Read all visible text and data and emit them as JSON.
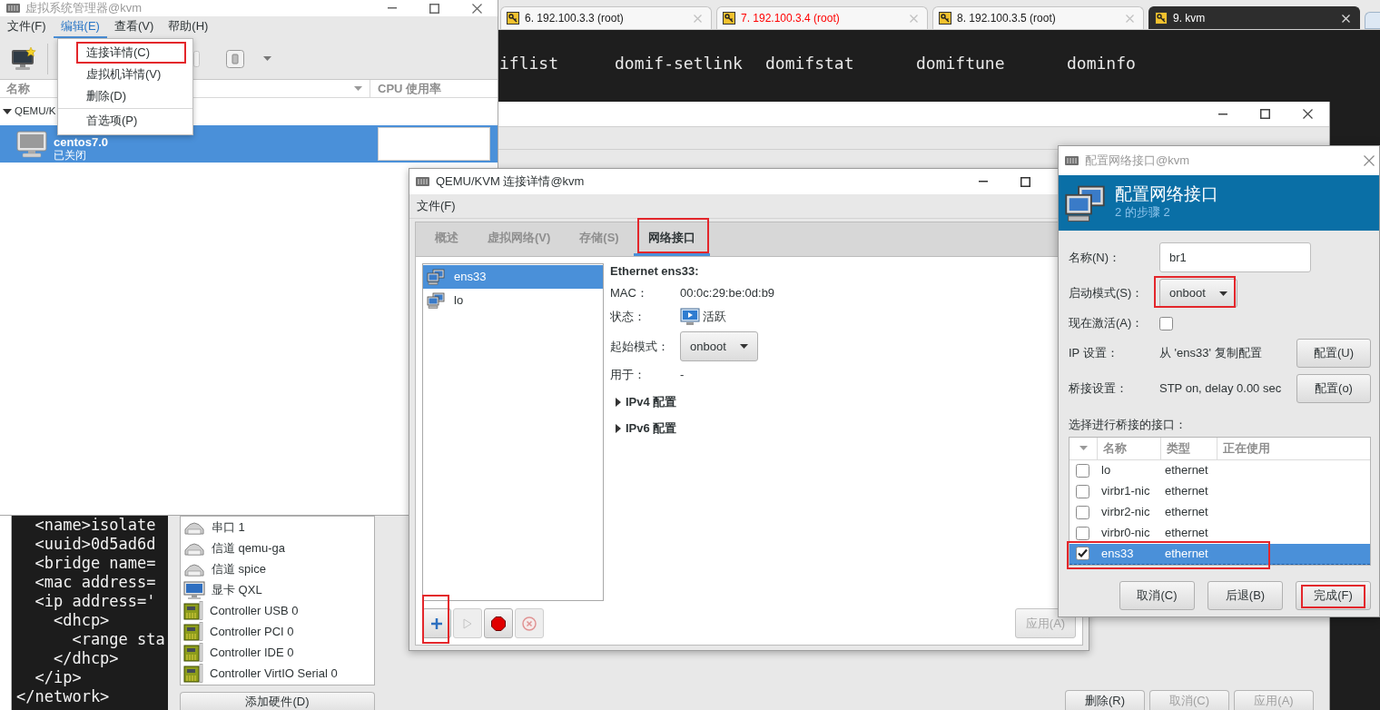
{
  "vm_manager": {
    "title": "虚拟系统管理器@kvm",
    "menus": [
      {
        "label": "文件(F)",
        "selected": false
      },
      {
        "label": "编辑(E)",
        "selected": true
      },
      {
        "label": "查看(V)",
        "selected": false
      },
      {
        "label": "帮助(H)",
        "selected": false
      }
    ],
    "open_menu": {
      "sections": [
        {
          "items": [
            {
              "label": "连接详情(C)",
              "annotated": true
            },
            {
              "label": "虚拟机详情(V)",
              "annotated": false
            },
            {
              "label": "删除(D)",
              "annotated": false
            }
          ]
        },
        {
          "items": [
            {
              "label": "首选项(P)",
              "annotated": false
            }
          ]
        }
      ]
    },
    "columns": [
      "名称",
      "CPU 使用率"
    ],
    "groups": [
      {
        "label": "QEMU/K",
        "expanded": true,
        "vms": [
          {
            "name": "centos7.0",
            "status": "已关闭",
            "selected": true
          }
        ]
      }
    ]
  },
  "terminal": {
    "tabs": [
      {
        "label": "6. 192.100.3.3 (root)",
        "selected": false,
        "color": "#1a1a1a"
      },
      {
        "label": "7. 192.100.3.4 (root)",
        "selected": false,
        "color": "#ff0000"
      },
      {
        "label": "8. 192.100.3.5 (root)",
        "selected": false,
        "color": "#1a1a1a"
      },
      {
        "label": "9. kvm",
        "selected": true
      }
    ],
    "output": [
      "iflist",
      "domif-setlink",
      "domifstat",
      "domiftune",
      "dominfo"
    ]
  },
  "connection_details": {
    "title": "QEMU/KVM 连接详情@kvm",
    "menus": [
      "文件(F)"
    ],
    "tabs": [
      {
        "label": "概述",
        "selected": false,
        "annotated": false
      },
      {
        "label": "虚拟网络(V)",
        "selected": false,
        "annotated": false
      },
      {
        "label": "存储(S)",
        "selected": false,
        "annotated": false
      },
      {
        "label": "网络接口",
        "selected": true,
        "annotated": true
      }
    ],
    "interfaces": [
      {
        "name": "ens33",
        "selected": true
      },
      {
        "name": "lo",
        "selected": false
      }
    ],
    "heading": "Ethernet ens33:",
    "fields": [
      {
        "kind": "text",
        "label": "MAC：",
        "value": "00:0c:29:be:0d:b9"
      },
      {
        "kind": "status",
        "label": "状态：",
        "value": "活跃"
      },
      {
        "kind": "dropdown",
        "label": "起始模式：",
        "value": "onboot"
      },
      {
        "kind": "text",
        "label": "用于：",
        "value": "-"
      }
    ],
    "sections": [
      {
        "label": "IPv4 配置",
        "expanded": false
      },
      {
        "label": "IPv6 配置",
        "expanded": false
      }
    ],
    "actions": [
      {
        "kind": "add",
        "disabled": false,
        "annotated": true
      },
      {
        "kind": "start",
        "disabled": true,
        "annotated": false
      },
      {
        "kind": "stop",
        "disabled": false,
        "annotated": false
      },
      {
        "kind": "delete",
        "disabled": true,
        "annotated": false
      }
    ],
    "apply_button": {
      "label": "应用(A)",
      "disabled": true
    }
  },
  "config_dialog": {
    "title": "配置网络接口@kvm",
    "heading": "配置网络接口",
    "step": "2 的步骤 2",
    "fields": [
      {
        "kind": "input",
        "label": "名称(N)：",
        "value": "br1",
        "annotated": false
      },
      {
        "kind": "dropdown",
        "label": "启动模式(S)：",
        "value": "onboot",
        "annotated": true
      },
      {
        "kind": "checkbox",
        "label": "现在激活(A)：",
        "checked": false,
        "annotated": false
      },
      {
        "kind": "setting",
        "label": "IP 设置：",
        "value": "从 'ens33' 复制配置",
        "button": "配置(U)",
        "annotated": false
      },
      {
        "kind": "setting",
        "label": "桥接设置：",
        "value": "STP on, delay 0.00 sec",
        "button": "配置(o)",
        "annotated": false
      }
    ],
    "table_label": "选择进行桥接的接口：",
    "columns": [
      "名称",
      "类型",
      "正在使用"
    ],
    "rows": [
      {
        "name": "lo",
        "type": "ethernet",
        "checked": false,
        "selected": false,
        "annotated": false
      },
      {
        "name": "virbr1-nic",
        "type": "ethernet",
        "checked": false,
        "selected": false,
        "annotated": false
      },
      {
        "name": "virbr2-nic",
        "type": "ethernet",
        "checked": false,
        "selected": false,
        "annotated": false
      },
      {
        "name": "virbr0-nic",
        "type": "ethernet",
        "checked": false,
        "selected": false,
        "annotated": false
      },
      {
        "name": "ens33",
        "type": "ethernet",
        "checked": true,
        "selected": true,
        "annotated": true
      }
    ],
    "buttons": [
      {
        "label": "取消(C)",
        "annotated": false
      },
      {
        "label": "后退(B)",
        "annotated": false
      },
      {
        "label": "完成(F)",
        "annotated": true
      }
    ]
  },
  "code_panel": {
    "lines": [
      "  <name>isolate",
      "  <uuid>0d5ad6d",
      "  <bridge name=",
      "  <mac address=",
      "  <ip address='",
      "    <dhcp>",
      "      <range sta",
      "    </dhcp>",
      "  </ip>",
      "</network>"
    ]
  },
  "hardware": {
    "devices": [
      {
        "kind": "serial",
        "label": "串口 1"
      },
      {
        "kind": "channel",
        "label": "信道 qemu-ga"
      },
      {
        "kind": "channel",
        "label": "信道 spice"
      },
      {
        "kind": "display",
        "label": "显卡 QXL"
      },
      {
        "kind": "controller",
        "label": "Controller USB 0"
      },
      {
        "kind": "controller",
        "label": "Controller PCI 0"
      },
      {
        "kind": "controller",
        "label": "Controller IDE 0"
      },
      {
        "kind": "controller",
        "label": "Controller VirtIO Serial 0"
      }
    ],
    "add_button": "添加硬件(D)"
  },
  "back_window": {
    "buttons": [
      {
        "label": "删除(R)",
        "disabled": false
      },
      {
        "label": "取消(C)",
        "disabled": true
      },
      {
        "label": "应用(A)",
        "disabled": true
      }
    ]
  }
}
